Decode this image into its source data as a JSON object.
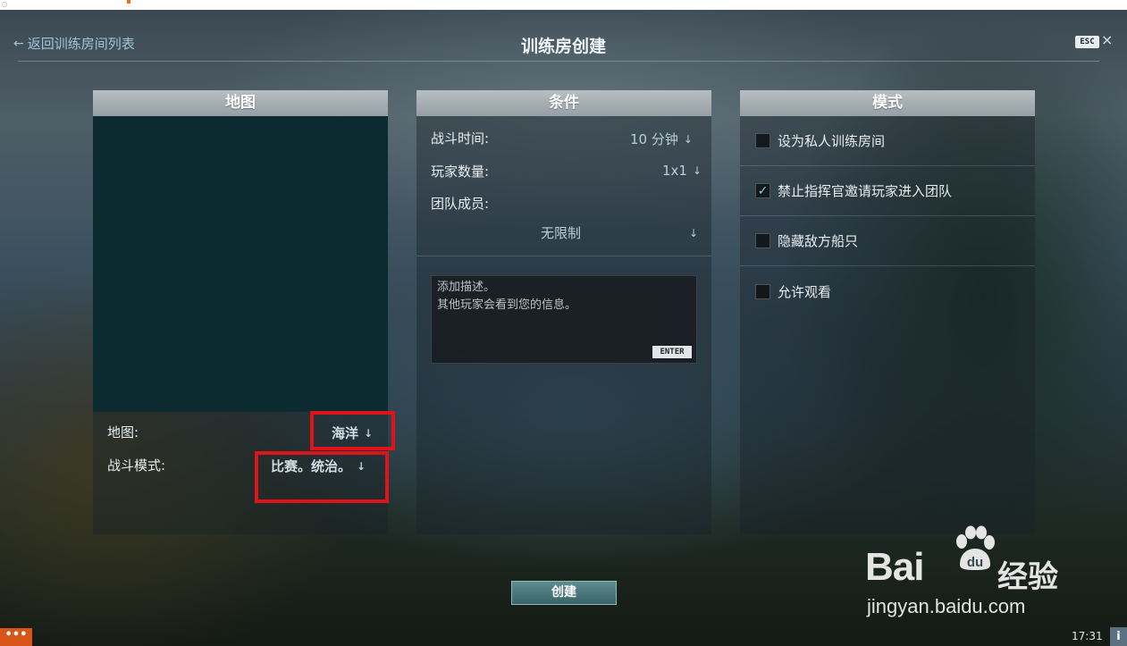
{
  "header": {
    "back_label": "返回训练房间列表",
    "title": "训练房创建",
    "esc_key": "ESC",
    "close_symbol": "×"
  },
  "map_panel": {
    "title": "地图",
    "map_label": "地图:",
    "map_value": "海洋",
    "mode_label": "战斗模式:",
    "mode_value": "比赛。统治。"
  },
  "conditions_panel": {
    "title": "条件",
    "battle_time_label": "战斗时间:",
    "battle_time_value": "10 分钟",
    "player_count_label": "玩家数量:",
    "player_count_value": "1x1",
    "team_members_label": "团队成员:",
    "team_members_value": "无限制",
    "description_placeholder": "添加描述。\n其他玩家会看到您的信息。",
    "enter_key": "ENTER"
  },
  "mode_panel": {
    "title": "模式",
    "options": [
      {
        "label": "设为私人训练房间",
        "checked": false
      },
      {
        "label": "禁止指挥官邀请玩家进入团队",
        "checked": true
      },
      {
        "label": "隐藏敌方船只",
        "checked": false
      },
      {
        "label": "允许观看",
        "checked": false
      }
    ]
  },
  "create_button": "创建",
  "watermark": {
    "brand": "Bai",
    "brand_cn": "经验",
    "url": "jingyan.baidu.com"
  },
  "taskbar": {
    "menu_label": "•••",
    "clock": "17:31",
    "info_label": "i"
  },
  "icons": {
    "back": "arrow-left-icon",
    "dropdown": "arrow-down-icon",
    "check": "checkmark-icon",
    "close": "close-icon"
  },
  "colors": {
    "panel_header": "#a6aeb2",
    "map_preview": "#0b2b31",
    "highlight": "#e0131b",
    "create_button": "#4f7a7d",
    "link": "#9fc6d8",
    "taskbar_menu": "#d8561a"
  }
}
